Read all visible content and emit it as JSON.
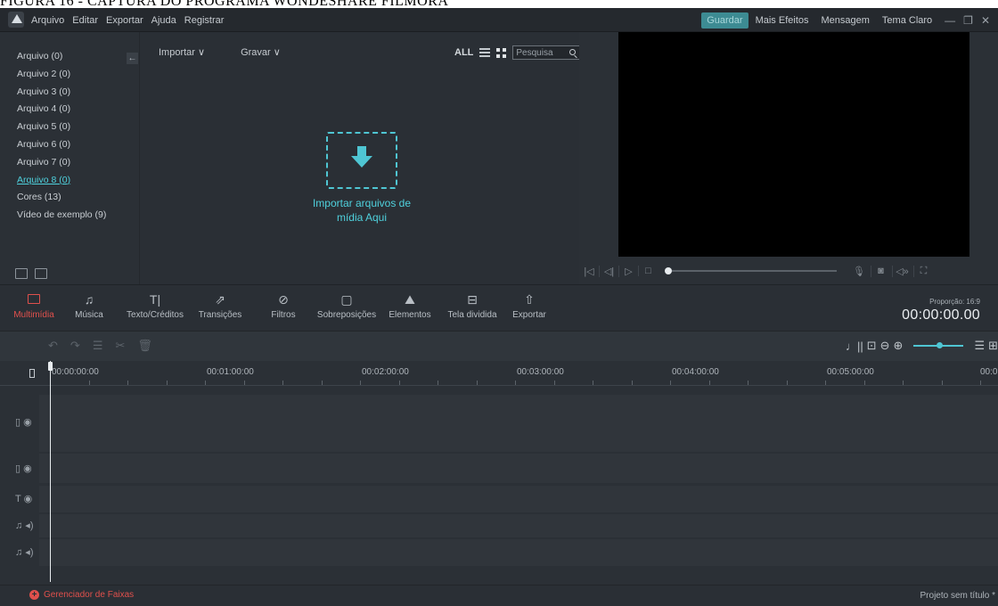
{
  "caption": "FIGURA 16 - CAPTURA DO PROGRAMA WONDESHARE FILMORA",
  "menu": [
    "Arquivo",
    "Editar",
    "Exportar",
    "Ajuda",
    "Registrar"
  ],
  "top_right": {
    "save": "Guardar",
    "links": [
      "Mais Efeitos",
      "Mensagem",
      "Tema Claro"
    ]
  },
  "library": {
    "items": [
      "Arquivo (0)",
      "Arquivo 2 (0)",
      "Arquivo 3 (0)",
      "Arquivo 4 (0)",
      "Arquivo 5 (0)",
      "Arquivo 6 (0)",
      "Arquivo 7 (0)",
      "Arquivo 8 (0)",
      "Cores (13)",
      "Vídeo de exemplo (9)"
    ],
    "active_index": 7
  },
  "media": {
    "import_label": "Importar ∨",
    "record_label": "Gravar ∨",
    "all_label": "ALL",
    "search_placeholder": "Pesquisa",
    "drop_text_line1": "Importar arquivos de",
    "drop_text_line2": "mídia Aqui"
  },
  "tools": {
    "items": [
      "Multimídia",
      "Música",
      "Texto/Créditos",
      "Transições",
      "Filtros",
      "Sobreposições",
      "Elementos",
      "Tela dividida",
      "Exportar"
    ],
    "ratio": "Proporção: 16:9",
    "timecode": "00:00:00.00"
  },
  "ruler": {
    "labels": [
      "00:00:00:00",
      "00:01:00:00",
      "00:02:00:00",
      "00:03:00:00",
      "00:04:00:00",
      "00:05:00:00",
      "00:0"
    ]
  },
  "footer": {
    "track_manager": "Gerenciador de Faixas",
    "project": "Projeto sem título *"
  },
  "colors": {
    "accent": "#4fc6d3",
    "active_red": "#e0504c",
    "save_button": "#3d8b93"
  }
}
